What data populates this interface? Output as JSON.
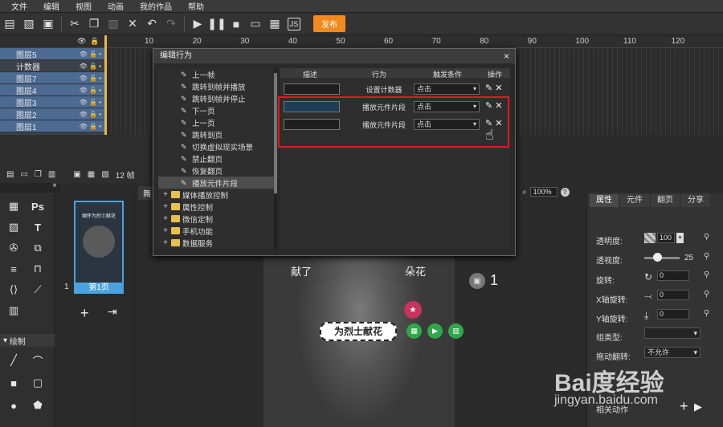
{
  "menu": [
    "文件",
    "编辑",
    "视图",
    "动画",
    "我的作品",
    "帮助"
  ],
  "toolbar": {
    "publish_label": "发布"
  },
  "ruler": {
    "ticks": [
      "10",
      "20",
      "30",
      "40",
      "50",
      "60",
      "70",
      "80",
      "90",
      "100",
      "110",
      "120"
    ]
  },
  "layers": [
    {
      "name": "图层5",
      "selected": true
    },
    {
      "name": "计数器",
      "selected": false
    },
    {
      "name": "图层7",
      "selected": true
    },
    {
      "name": "图层4",
      "selected": true
    },
    {
      "name": "图层3",
      "selected": true
    },
    {
      "name": "图层2",
      "selected": true
    },
    {
      "name": "图层1",
      "selected": true
    }
  ],
  "timeline": {
    "frame_text": "12 帧"
  },
  "tools": {
    "ps_label": "Ps",
    "draw_label": "绘制"
  },
  "pages": {
    "page_label": "第1页",
    "page_number": "1",
    "thumb_text": "缅怀为烈士献花"
  },
  "canvas": {
    "tab_label": "舞",
    "zoom": "100%",
    "help": "?"
  },
  "stage": {
    "text_left": "献了",
    "text_right": "朵花",
    "button_text": "为烈士献花",
    "counter": "1"
  },
  "right_tabs": [
    {
      "label": "属性",
      "active": true
    },
    {
      "label": "元件",
      "active": false
    },
    {
      "label": "翻页",
      "active": false
    },
    {
      "label": "分享",
      "active": false
    }
  ],
  "props": {
    "opacity_label": "透明度:",
    "opacity_value": "100",
    "transparency_label": "透视度:",
    "transparency_value": "25",
    "rotate_label": "旋转:",
    "rotate_value": "0",
    "xrot_label": "X轴旋转:",
    "xrot_value": "0",
    "yrot_label": "Y轴旋转:",
    "yrot_value": "0",
    "group_label": "组类型:",
    "drag_label": "拖动翻转:",
    "drag_value": "不允许",
    "extra_label": "相关动作"
  },
  "dialog": {
    "title": "编辑行为",
    "close": "×",
    "tree": [
      {
        "label": "上一帧",
        "type": "item"
      },
      {
        "label": "跳转到帧并播放",
        "type": "item"
      },
      {
        "label": "跳转到帧并停止",
        "type": "item"
      },
      {
        "label": "下一页",
        "type": "item"
      },
      {
        "label": "上一页",
        "type": "item"
      },
      {
        "label": "跳转到页",
        "type": "item"
      },
      {
        "label": "切换虚拟现实场景",
        "type": "item"
      },
      {
        "label": "禁止翻页",
        "type": "item"
      },
      {
        "label": "恢复翻页",
        "type": "item"
      },
      {
        "label": "播放元件片段",
        "type": "item",
        "selected": true
      },
      {
        "label": "媒体播放控制",
        "type": "folder"
      },
      {
        "label": "属性控制",
        "type": "folder"
      },
      {
        "label": "微信定制",
        "type": "folder"
      },
      {
        "label": "手机功能",
        "type": "folder"
      },
      {
        "label": "数据服务",
        "type": "folder"
      }
    ],
    "columns": [
      "描述",
      "行为",
      "触发条件",
      "操作"
    ],
    "rows": [
      {
        "action": "设置计数器",
        "trigger": "点击",
        "highlight": false
      },
      {
        "action": "播放元件片段",
        "trigger": "点击",
        "highlight": true
      },
      {
        "action": "播放元件片段",
        "trigger": "点击",
        "highlight": false
      }
    ]
  },
  "watermark": {
    "line1": "Bai度经验",
    "line2": "jingyan.baidu.com"
  }
}
